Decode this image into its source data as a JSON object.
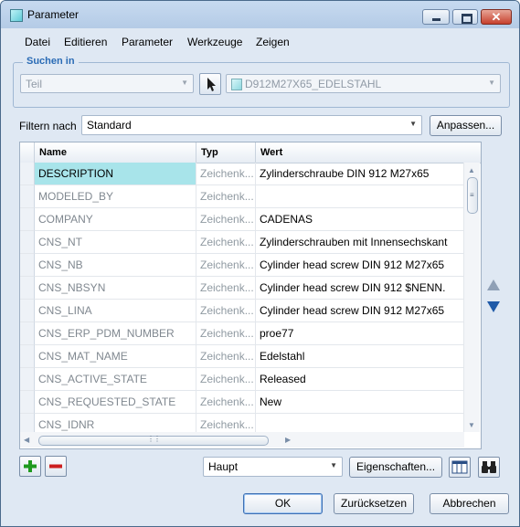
{
  "window": {
    "title": "Parameter"
  },
  "menu": [
    "Datei",
    "Editieren",
    "Parameter",
    "Werkzeuge",
    "Zeigen"
  ],
  "search_group": {
    "title": "Suchen in",
    "scope_value": "Teil",
    "part_value": "D912M27X65_EDELSTAHL"
  },
  "filter": {
    "label": "Filtern nach",
    "value": "Standard",
    "customize_button": "Anpassen..."
  },
  "table": {
    "columns": [
      "Name",
      "Typ",
      "Wert"
    ],
    "rows": [
      {
        "name": "DESCRIPTION",
        "type": "Zeichenk...",
        "value": "Zylinderschraube DIN 912 M27x65"
      },
      {
        "name": "MODELED_BY",
        "type": "Zeichenk...",
        "value": ""
      },
      {
        "name": "COMPANY",
        "type": "Zeichenk...",
        "value": "CADENAS"
      },
      {
        "name": "CNS_NT",
        "type": "Zeichenk...",
        "value": "Zylinderschrauben mit Innensechskant"
      },
      {
        "name": "CNS_NB",
        "type": "Zeichenk...",
        "value": "Cylinder head screw DIN 912 M27x65"
      },
      {
        "name": "CNS_NBSYN",
        "type": "Zeichenk...",
        "value": "Cylinder head screw DIN 912 $NENN."
      },
      {
        "name": "CNS_LINA",
        "type": "Zeichenk...",
        "value": "Cylinder head screw DIN 912 M27x65"
      },
      {
        "name": "CNS_ERP_PDM_NUMBER",
        "type": "Zeichenk...",
        "value": "proe77"
      },
      {
        "name": "CNS_MAT_NAME",
        "type": "Zeichenk...",
        "value": "Edelstahl"
      },
      {
        "name": "CNS_ACTIVE_STATE",
        "type": "Zeichenk...",
        "value": "Released"
      },
      {
        "name": "CNS_REQUESTED_STATE",
        "type": "Zeichenk...",
        "value": "New"
      },
      {
        "name": "CNS_IDNR",
        "type": "Zeichenk...",
        "value": ""
      }
    ],
    "selected_row": 0
  },
  "bottom": {
    "view_value": "Haupt",
    "properties_button": "Eigenschaften..."
  },
  "dialog_buttons": {
    "ok": "OK",
    "reset": "Zurücksetzen",
    "cancel": "Abbrechen"
  },
  "colors": {
    "selection": "#a8e4ea",
    "accent": "#2a6bb5",
    "add": "#1f9a1f",
    "remove": "#cc1f1f",
    "move_arrow": "#1f5aa8"
  }
}
